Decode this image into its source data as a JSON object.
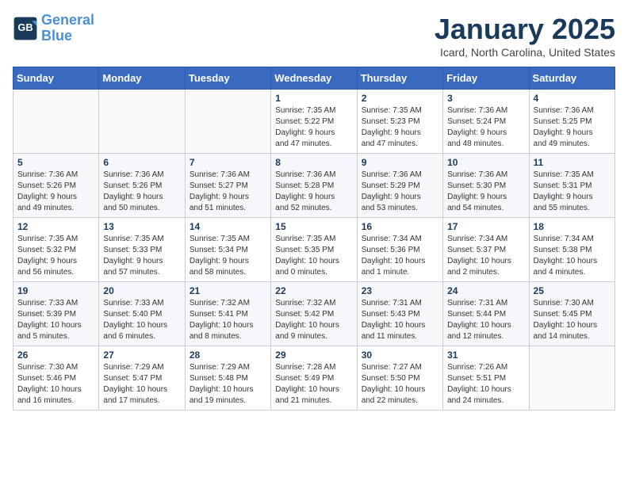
{
  "header": {
    "logo_line1": "General",
    "logo_line2": "Blue",
    "month_title": "January 2025",
    "location": "Icard, North Carolina, United States"
  },
  "weekdays": [
    "Sunday",
    "Monday",
    "Tuesday",
    "Wednesday",
    "Thursday",
    "Friday",
    "Saturday"
  ],
  "weeks": [
    [
      {
        "day": "",
        "info": ""
      },
      {
        "day": "",
        "info": ""
      },
      {
        "day": "",
        "info": ""
      },
      {
        "day": "1",
        "info": "Sunrise: 7:35 AM\nSunset: 5:22 PM\nDaylight: 9 hours\nand 47 minutes."
      },
      {
        "day": "2",
        "info": "Sunrise: 7:35 AM\nSunset: 5:23 PM\nDaylight: 9 hours\nand 47 minutes."
      },
      {
        "day": "3",
        "info": "Sunrise: 7:36 AM\nSunset: 5:24 PM\nDaylight: 9 hours\nand 48 minutes."
      },
      {
        "day": "4",
        "info": "Sunrise: 7:36 AM\nSunset: 5:25 PM\nDaylight: 9 hours\nand 49 minutes."
      }
    ],
    [
      {
        "day": "5",
        "info": "Sunrise: 7:36 AM\nSunset: 5:26 PM\nDaylight: 9 hours\nand 49 minutes."
      },
      {
        "day": "6",
        "info": "Sunrise: 7:36 AM\nSunset: 5:26 PM\nDaylight: 9 hours\nand 50 minutes."
      },
      {
        "day": "7",
        "info": "Sunrise: 7:36 AM\nSunset: 5:27 PM\nDaylight: 9 hours\nand 51 minutes."
      },
      {
        "day": "8",
        "info": "Sunrise: 7:36 AM\nSunset: 5:28 PM\nDaylight: 9 hours\nand 52 minutes."
      },
      {
        "day": "9",
        "info": "Sunrise: 7:36 AM\nSunset: 5:29 PM\nDaylight: 9 hours\nand 53 minutes."
      },
      {
        "day": "10",
        "info": "Sunrise: 7:36 AM\nSunset: 5:30 PM\nDaylight: 9 hours\nand 54 minutes."
      },
      {
        "day": "11",
        "info": "Sunrise: 7:35 AM\nSunset: 5:31 PM\nDaylight: 9 hours\nand 55 minutes."
      }
    ],
    [
      {
        "day": "12",
        "info": "Sunrise: 7:35 AM\nSunset: 5:32 PM\nDaylight: 9 hours\nand 56 minutes."
      },
      {
        "day": "13",
        "info": "Sunrise: 7:35 AM\nSunset: 5:33 PM\nDaylight: 9 hours\nand 57 minutes."
      },
      {
        "day": "14",
        "info": "Sunrise: 7:35 AM\nSunset: 5:34 PM\nDaylight: 9 hours\nand 58 minutes."
      },
      {
        "day": "15",
        "info": "Sunrise: 7:35 AM\nSunset: 5:35 PM\nDaylight: 10 hours\nand 0 minutes."
      },
      {
        "day": "16",
        "info": "Sunrise: 7:34 AM\nSunset: 5:36 PM\nDaylight: 10 hours\nand 1 minute."
      },
      {
        "day": "17",
        "info": "Sunrise: 7:34 AM\nSunset: 5:37 PM\nDaylight: 10 hours\nand 2 minutes."
      },
      {
        "day": "18",
        "info": "Sunrise: 7:34 AM\nSunset: 5:38 PM\nDaylight: 10 hours\nand 4 minutes."
      }
    ],
    [
      {
        "day": "19",
        "info": "Sunrise: 7:33 AM\nSunset: 5:39 PM\nDaylight: 10 hours\nand 5 minutes."
      },
      {
        "day": "20",
        "info": "Sunrise: 7:33 AM\nSunset: 5:40 PM\nDaylight: 10 hours\nand 6 minutes."
      },
      {
        "day": "21",
        "info": "Sunrise: 7:32 AM\nSunset: 5:41 PM\nDaylight: 10 hours\nand 8 minutes."
      },
      {
        "day": "22",
        "info": "Sunrise: 7:32 AM\nSunset: 5:42 PM\nDaylight: 10 hours\nand 9 minutes."
      },
      {
        "day": "23",
        "info": "Sunrise: 7:31 AM\nSunset: 5:43 PM\nDaylight: 10 hours\nand 11 minutes."
      },
      {
        "day": "24",
        "info": "Sunrise: 7:31 AM\nSunset: 5:44 PM\nDaylight: 10 hours\nand 12 minutes."
      },
      {
        "day": "25",
        "info": "Sunrise: 7:30 AM\nSunset: 5:45 PM\nDaylight: 10 hours\nand 14 minutes."
      }
    ],
    [
      {
        "day": "26",
        "info": "Sunrise: 7:30 AM\nSunset: 5:46 PM\nDaylight: 10 hours\nand 16 minutes."
      },
      {
        "day": "27",
        "info": "Sunrise: 7:29 AM\nSunset: 5:47 PM\nDaylight: 10 hours\nand 17 minutes."
      },
      {
        "day": "28",
        "info": "Sunrise: 7:29 AM\nSunset: 5:48 PM\nDaylight: 10 hours\nand 19 minutes."
      },
      {
        "day": "29",
        "info": "Sunrise: 7:28 AM\nSunset: 5:49 PM\nDaylight: 10 hours\nand 21 minutes."
      },
      {
        "day": "30",
        "info": "Sunrise: 7:27 AM\nSunset: 5:50 PM\nDaylight: 10 hours\nand 22 minutes."
      },
      {
        "day": "31",
        "info": "Sunrise: 7:26 AM\nSunset: 5:51 PM\nDaylight: 10 hours\nand 24 minutes."
      },
      {
        "day": "",
        "info": ""
      }
    ]
  ]
}
